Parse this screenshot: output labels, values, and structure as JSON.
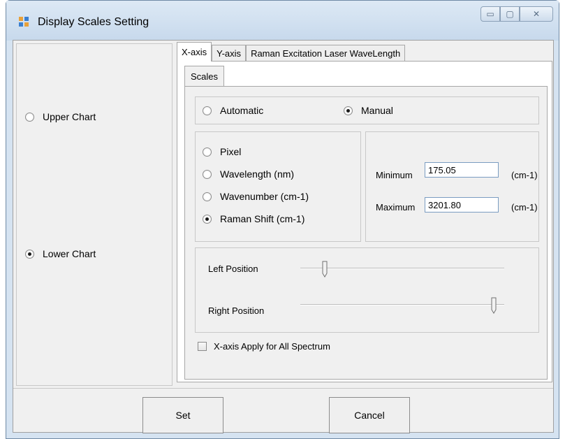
{
  "window": {
    "title": "Display Scales Setting"
  },
  "titlebar_buttons": {
    "minimize": "▭",
    "maximize": "▢",
    "close": "✕"
  },
  "chart_select": {
    "upper": {
      "label": "Upper Chart",
      "checked": false
    },
    "lower": {
      "label": "Lower Chart",
      "checked": true
    }
  },
  "tabs": [
    {
      "label": "X-axis",
      "active": true
    },
    {
      "label": "Y-axis",
      "active": false
    },
    {
      "label": "Raman Excitation Laser WaveLength",
      "active": false
    }
  ],
  "subtabs": [
    {
      "label": "Scales",
      "active": true
    }
  ],
  "scale_mode": {
    "automatic": {
      "label": "Automatic",
      "checked": false
    },
    "manual": {
      "label": "Manual",
      "checked": true
    }
  },
  "units": [
    {
      "label": "Pixel",
      "checked": false
    },
    {
      "label": "Wavelength (nm)",
      "checked": false
    },
    {
      "label": "Wavenumber (cm-1)",
      "checked": false
    },
    {
      "label": "Raman Shift (cm-1)",
      "checked": true
    }
  ],
  "range": {
    "minimum_label": "Minimum",
    "minimum_value": "175.05",
    "minimum_unit": "(cm-1)",
    "maximum_label": "Maximum",
    "maximum_value": "3201.80",
    "maximum_unit": "(cm-1)"
  },
  "sliders": {
    "left_label": "Left Position",
    "left_value": 0.12,
    "right_label": "Right Position",
    "right_value": 0.95
  },
  "apply_all": {
    "label": "X-axis Apply for All Spectrum",
    "checked": false
  },
  "buttons": {
    "set": "Set",
    "cancel": "Cancel"
  }
}
